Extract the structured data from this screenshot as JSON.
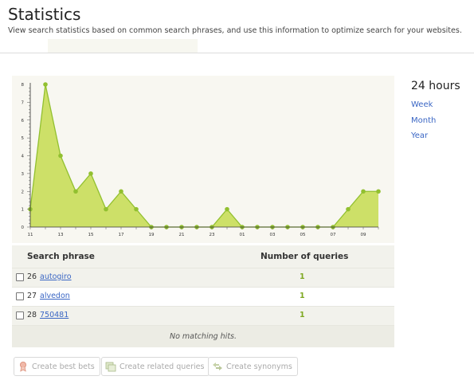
{
  "header": {
    "title": "Statistics",
    "subtitle": "View search statistics based on common search phrases, and use this information to optimize search for your websites."
  },
  "range": {
    "selected": "24 hours",
    "options": [
      "Week",
      "Month",
      "Year"
    ]
  },
  "chart_data": {
    "type": "area",
    "x": [
      "11",
      "12",
      "13",
      "14",
      "15",
      "16",
      "17",
      "18",
      "19",
      "20",
      "21",
      "22",
      "23",
      "00",
      "01",
      "02",
      "03",
      "04",
      "05",
      "06",
      "07",
      "08",
      "09",
      "10"
    ],
    "xtick_labels": [
      "11",
      "13",
      "15",
      "17",
      "19",
      "21",
      "23",
      "01",
      "03",
      "05",
      "07",
      "09"
    ],
    "values": [
      1,
      8,
      4,
      2,
      3,
      1,
      2,
      1,
      0,
      0,
      0,
      0,
      0,
      1,
      0,
      0,
      0,
      0,
      0,
      0,
      0,
      1,
      2,
      2
    ],
    "ylim": [
      0,
      8
    ],
    "yticks": [
      0,
      1,
      2,
      3,
      4,
      5,
      6,
      7,
      8
    ],
    "fill_color": "#cde068",
    "line_color": "#92c030",
    "grid": false
  },
  "table": {
    "headers": {
      "phrase": "Search phrase",
      "count": "Number of queries"
    },
    "rows": [
      {
        "rank": "26",
        "phrase": "autogiro",
        "count": "1"
      },
      {
        "rank": "27",
        "phrase": "alvedon",
        "count": "1"
      },
      {
        "rank": "28",
        "phrase": "750481",
        "count": "1"
      }
    ],
    "empty_message": "No matching hits."
  },
  "actions": {
    "best_bets": "Create best bets",
    "related": "Create related queries",
    "synonyms": "Create synonyms"
  }
}
